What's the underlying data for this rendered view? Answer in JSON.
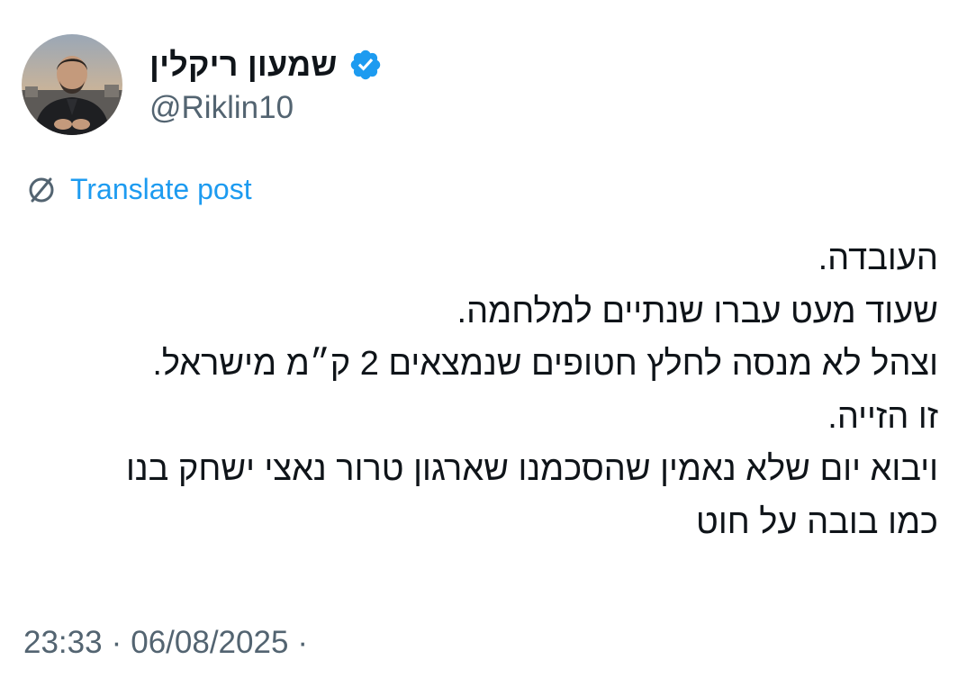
{
  "author": {
    "display_name": "שמעון ריקלין",
    "handle": "@Riklin10",
    "verified": true,
    "avatar_icon": "profile-photo"
  },
  "translate": {
    "label": "Translate post",
    "icon": "translate-globe-icon"
  },
  "post": {
    "lines": [
      "העובדה.",
      "שעוד מעט עברו שנתיים למלחמה.",
      "וצהל לא מנסה לחלץ חטופים שנמצאים 2 ק״מ מישראל.",
      "זו הזייה.",
      "ויבוא יום שלא נאמין שהסכמנו שארגון טרור נאצי ישחק בנו",
      "כמו בובה על חוט"
    ]
  },
  "meta": {
    "time": "23:33",
    "separator": "·",
    "date": "06/08/2025",
    "trailing": "·"
  },
  "colors": {
    "link": "#1d9bf0",
    "secondary_text": "#536471",
    "primary_text": "#0f1419",
    "verified_badge": "#1d9bf0"
  }
}
